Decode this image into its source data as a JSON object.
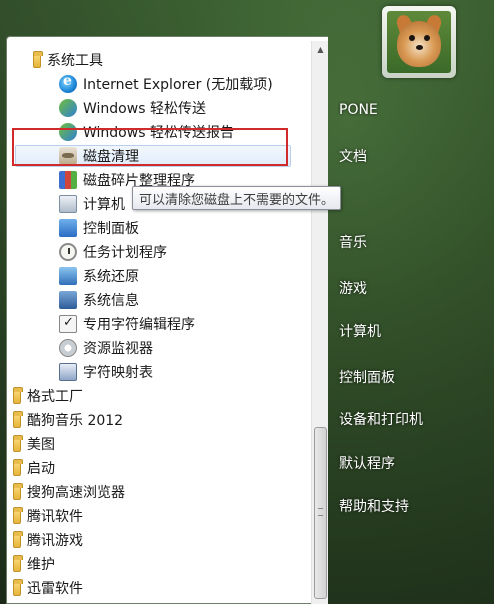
{
  "programs": {
    "folder_open": "系统工具",
    "sub_items": [
      {
        "label": "Internet Explorer (无加载项)",
        "icon": "internet-explorer-icon"
      },
      {
        "label": "Windows 轻松传送",
        "icon": "easy-transfer-icon"
      },
      {
        "label": "Windows 轻松传送报告",
        "icon": "easy-transfer-report-icon"
      },
      {
        "label": "磁盘清理",
        "icon": "disk-cleanup-icon"
      },
      {
        "label": "磁盘碎片整理程序",
        "icon": "defragmenter-icon"
      },
      {
        "label": "计算机",
        "icon": "computer-icon"
      },
      {
        "label": "控制面板",
        "icon": "control-panel-icon"
      },
      {
        "label": "任务计划程序",
        "icon": "task-scheduler-icon"
      },
      {
        "label": "系统还原",
        "icon": "system-restore-icon"
      },
      {
        "label": "系统信息",
        "icon": "system-info-icon"
      },
      {
        "label": "专用字符编辑程序",
        "icon": "private-char-editor-icon"
      },
      {
        "label": "资源监视器",
        "icon": "resource-monitor-icon"
      },
      {
        "label": "字符映射表",
        "icon": "character-map-icon"
      }
    ],
    "folders": [
      "格式工厂",
      "酷狗音乐 2012",
      "美图",
      "启动",
      "搜狗高速浏览器",
      "腾讯软件",
      "腾讯游戏",
      "维护",
      "迅雷软件"
    ]
  },
  "tooltip": "可以清除您磁盘上不需要的文件。",
  "right_menu": [
    "PONE",
    "文档",
    "音乐",
    "游戏",
    "计算机",
    "控制面板",
    "设备和打印机",
    "默认程序",
    "帮助和支持"
  ],
  "colors": {
    "highlight": "#d12a2a",
    "selected_bg": "#e0ecfa",
    "text": "#1a1a1a"
  }
}
